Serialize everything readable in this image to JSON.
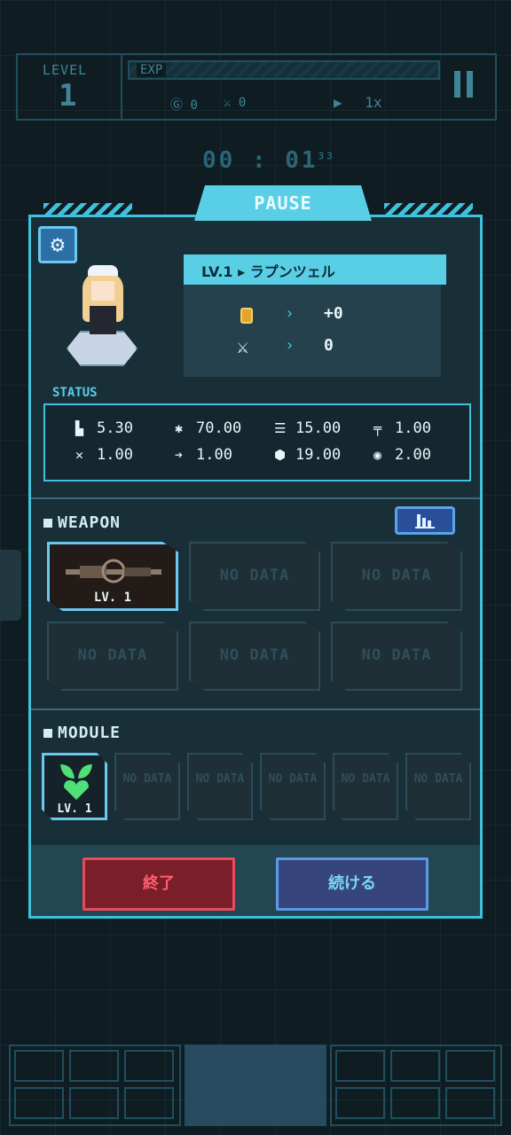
{
  "hud": {
    "level_label": "LEVEL",
    "level_value": "1",
    "exp_label": "EXP",
    "coins": "0",
    "kills": "0",
    "speed": "1x"
  },
  "timer": {
    "main": "00 : 01",
    "sub": "33"
  },
  "panel": {
    "title": "PAUSE",
    "character": {
      "name": "LV.1 ▸ ラプンツェル",
      "coin_gain": "+0",
      "kill_gain": "0"
    },
    "status_label": "STATUS",
    "stats": [
      {
        "icon": "boot-icon",
        "glyph": "▙",
        "value": "5.30"
      },
      {
        "icon": "burst-icon",
        "glyph": "✱",
        "value": "70.00"
      },
      {
        "icon": "rate-icon",
        "glyph": "☰",
        "value": "15.00"
      },
      {
        "icon": "gun-icon",
        "glyph": "╤",
        "value": "1.00"
      },
      {
        "icon": "crit-icon",
        "glyph": "✕",
        "value": "1.00"
      },
      {
        "icon": "dash-icon",
        "glyph": "➔",
        "value": "1.00"
      },
      {
        "icon": "shield-icon",
        "glyph": "⬢",
        "value": "19.00"
      },
      {
        "icon": "range-icon",
        "glyph": "◉",
        "value": "2.00"
      }
    ],
    "weapon_title": "WEAPON",
    "weapons": [
      {
        "filled": true,
        "level": "LV. 1"
      },
      {
        "filled": false,
        "label": "NO DATA"
      },
      {
        "filled": false,
        "label": "NO DATA"
      },
      {
        "filled": false,
        "label": "NO DATA"
      },
      {
        "filled": false,
        "label": "NO DATA"
      },
      {
        "filled": false,
        "label": "NO DATA"
      }
    ],
    "module_title": "MODULE",
    "modules": [
      {
        "filled": true,
        "level": "LV. 1"
      },
      {
        "filled": false,
        "label": "NO DATA"
      },
      {
        "filled": false,
        "label": "NO DATA"
      },
      {
        "filled": false,
        "label": "NO DATA"
      },
      {
        "filled": false,
        "label": "NO DATA"
      },
      {
        "filled": false,
        "label": "NO DATA"
      }
    ],
    "end_label": "終了",
    "continue_label": "続ける"
  },
  "colors": {
    "accent": "#3fc0dd",
    "danger": "#e84a5a",
    "confirm": "#5a9ae6",
    "module_green": "#4fe07a"
  }
}
